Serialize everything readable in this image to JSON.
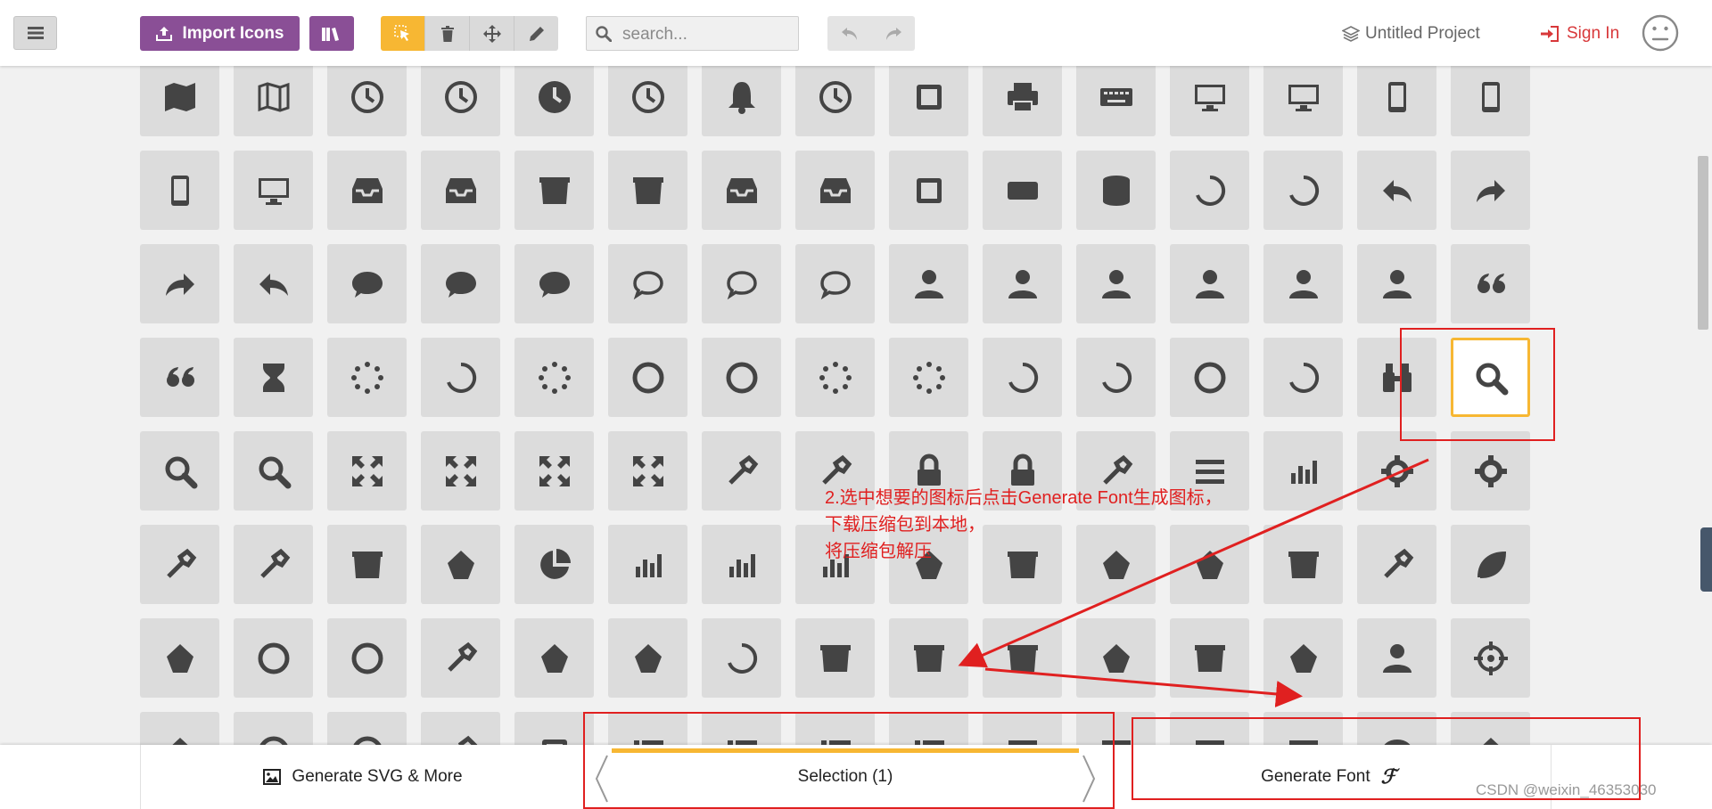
{
  "toolbar": {
    "import_label": "Import Icons",
    "search_placeholder": "search...",
    "project_name": "Untitled Project",
    "signin_label": "Sign In"
  },
  "footer": {
    "generate_svg_label": "Generate SVG & More",
    "selection_label": "Selection (1)",
    "generate_font_label": "Generate Font",
    "font_glyph": "ℱ"
  },
  "annotation": {
    "line1": "2.选中想要的图标后点击Generate Font生成图标，",
    "line2": "下载压缩包到本地，",
    "line3": "将压缩包解压"
  },
  "watermark": "CSDN @weixin_46353030",
  "colors": {
    "accent_purple": "#8a4f96",
    "accent_yellow": "#f7b733",
    "annotation_red": "#e02020",
    "icon_gray": "#444444"
  },
  "icon_rows": [
    [
      "map-icon",
      "map-outline-icon",
      "history-icon",
      "clock-outline-icon",
      "clock-icon",
      "alarm-icon",
      "bell-icon",
      "stopwatch-icon",
      "calendar-icon",
      "printer-icon",
      "keyboard-icon",
      "display-icon",
      "laptop-icon",
      "mobile-icon",
      "tablet-icon"
    ],
    [
      "tablet-vertical-icon",
      "tv-icon",
      "drawer-icon",
      "inbox-icon",
      "box-add-icon",
      "box-remove-icon",
      "download-icon",
      "upload-icon",
      "floppy-disk-icon",
      "drive-icon",
      "database-icon",
      "undo-icon",
      "redo-icon",
      "reply-icon",
      "forward-icon"
    ],
    [
      "share-icon",
      "turn-left-icon",
      "bubble-icon",
      "bubbles-icon",
      "bubbles-2-icon",
      "bubble-outline-icon",
      "bubbles-outline-icon",
      "bubbles-2-outline-icon",
      "user-icon",
      "users-icon",
      "user-plus-icon",
      "user-minus-icon",
      "user-check-icon",
      "user-tie-icon",
      "quotes-left-icon"
    ],
    [
      "quotes-right-icon",
      "hourglass-icon",
      "spinner-dots-icon",
      "spinner-arc-icon",
      "spinner-rays-icon",
      "spinner-ring-icon",
      "spinner-circle-icon",
      "spinner-dots-2-icon",
      "spinner-dots-3-icon",
      "spinner-open-icon",
      "spinner-arrows-icon",
      "spinner-segments-icon",
      "spinner-refresh-icon",
      "binoculars-icon",
      "search-icon"
    ],
    [
      "zoom-in-icon",
      "zoom-out-icon",
      "enlarge-icon",
      "shrink-icon",
      "enlarge-2-icon",
      "shrink-2-icon",
      "key-icon",
      "key-2-icon",
      "lock-icon",
      "unlocked-icon",
      "wrench-icon",
      "equalizer-icon",
      "equalizer-vertical-icon",
      "cog-icon",
      "cogs-icon"
    ],
    [
      "hammer-icon",
      "magic-wand-icon",
      "aid-kit-icon",
      "bug-icon",
      "pie-chart-icon",
      "stats-dots-icon",
      "stats-bars-icon",
      "stats-bars-2-icon",
      "trophy-icon",
      "gift-icon",
      "glass-icon",
      "cocktail-icon",
      "mug-icon",
      "spoon-knife-icon",
      "leaf-icon"
    ],
    [
      "rocket-icon",
      "meter-icon",
      "meter-2-icon",
      "hammer-2-icon",
      "fire-icon",
      "lab-icon",
      "magnet-icon",
      "bin-icon",
      "bin-2-icon",
      "briefcase-icon",
      "airplane-icon",
      "truck-icon",
      "road-icon",
      "accessibility-icon",
      "target-icon"
    ],
    [
      "shield-icon",
      "power-icon",
      "switch-icon",
      "power-cord-icon",
      "clipboard-icon",
      "list-numbered-icon",
      "list-icon",
      "list-2-icon",
      "tree-icon",
      "menu-icon",
      "menu-2-icon",
      "menu-3-icon",
      "menu-4-icon",
      "cloud-icon",
      "heart-icon"
    ]
  ]
}
